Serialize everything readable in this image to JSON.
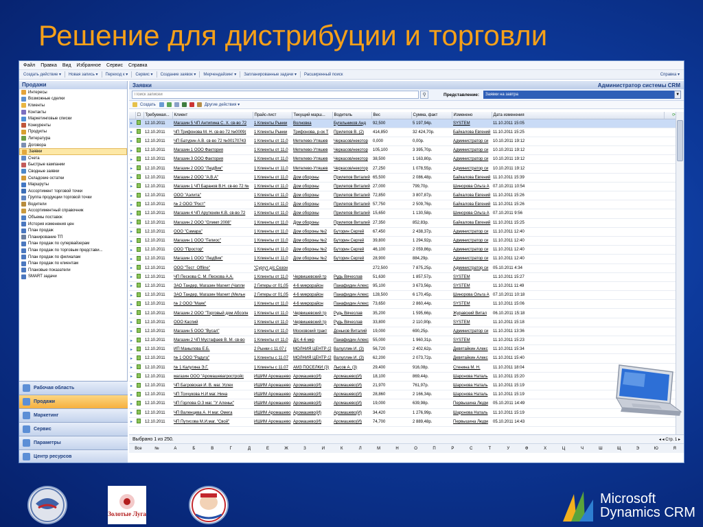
{
  "slide": {
    "title": "Решение для дистрибуции и торговли"
  },
  "colors": {
    "title": "#f5a019",
    "background": "#0d3a9c",
    "selected_row": "#c9dbf6",
    "active_nav": "#f6b03f"
  },
  "menu": [
    "Файл",
    "Правка",
    "Вид",
    "Избранное",
    "Сервис",
    "Справка"
  ],
  "toolbar": {
    "items": [
      "Создать действие ▾",
      "Новая запись ▾",
      "Переход к ▾",
      "Сервис ▾",
      "Создание заявок ▾",
      "Мерчендайзинг ▾",
      "Запланированные задачи ▾",
      "Расширенный поиск"
    ],
    "help": "Справка ▾"
  },
  "sidebar": {
    "title": "Продажи",
    "items": [
      {
        "label": "Интересы",
        "icon": "interest-icon"
      },
      {
        "label": "Возможные сделки",
        "icon": "deal-icon"
      },
      {
        "label": "Клиенты",
        "icon": "clients-icon"
      },
      {
        "label": "Контакты",
        "icon": "contacts-icon"
      },
      {
        "label": "Маркетинговые списки",
        "icon": "marketing-list-icon"
      },
      {
        "label": "Конкуренты",
        "icon": "competitors-icon"
      },
      {
        "label": "Продукты",
        "icon": "products-icon"
      },
      {
        "label": "Литература",
        "icon": "literature-icon"
      },
      {
        "label": "Договора",
        "icon": "contracts-icon"
      },
      {
        "label": "Заявки",
        "icon": "orders-icon",
        "active": true
      },
      {
        "label": "Счета",
        "icon": "invoices-icon"
      },
      {
        "label": "Быстрые кампании",
        "icon": "campaign-icon"
      },
      {
        "label": "Сводные заявки",
        "icon": "summary-orders-icon"
      },
      {
        "label": "Складские остатки",
        "icon": "stock-icon"
      },
      {
        "label": "Маршруты",
        "icon": "routes-icon"
      },
      {
        "label": "Ассортимент торговой точки",
        "icon": "assortment-icon"
      },
      {
        "label": "Группа продукции торговой точки",
        "icon": "product-group-icon"
      },
      {
        "label": "Водители",
        "icon": "drivers-icon"
      },
      {
        "label": "Ассортиментный справочник",
        "icon": "catalog-icon"
      },
      {
        "label": "Объемы поставок",
        "icon": "volume-icon"
      },
      {
        "label": "История изменения цен",
        "icon": "price-history-icon"
      },
      {
        "label": "План продаж",
        "icon": "sales-plan-icon"
      },
      {
        "label": "Планирование ТП",
        "icon": "planning-icon"
      },
      {
        "label": "План продаж по супервайзерам",
        "icon": "plan-supervisor-icon"
      },
      {
        "label": "План продаж по торговым представи...",
        "icon": "plan-rep-icon"
      },
      {
        "label": "План продаж по филиалам",
        "icon": "plan-branch-icon"
      },
      {
        "label": "План продаж по клиентам",
        "icon": "plan-client-icon"
      },
      {
        "label": "Плановые показатели",
        "icon": "targets-icon"
      },
      {
        "label": "SMART задачи",
        "icon": "smart-icon"
      }
    ]
  },
  "navbuttons": [
    {
      "label": "Рабочая область",
      "icon": "workplace-icon"
    },
    {
      "label": "Продажи",
      "icon": "sales-icon",
      "active": true
    },
    {
      "label": "Маркетинг",
      "icon": "marketing-icon"
    },
    {
      "label": "Сервис",
      "icon": "service-icon"
    },
    {
      "label": "Параметры",
      "icon": "settings-icon"
    },
    {
      "label": "Центр ресурсов",
      "icon": "resource-center-icon"
    }
  ],
  "main": {
    "title": "Заявки",
    "admin": "Администратор системы CRM",
    "search_placeholder": "Поиск записей",
    "view_label": "Представление:",
    "view_value": "Заявки на завтра",
    "actions": [
      "Создать",
      "Другие действия ▾"
    ]
  },
  "grid": {
    "columns": [
      "Требуемая...",
      "Клиент",
      "Прайс-лист",
      "Текущий марш...",
      "Водитель",
      "Вес",
      "Сумма, факт",
      "Изменено",
      "Дата изменения"
    ],
    "rows": [
      [
        "12.10.2011",
        "Магазин 5 ЧП Антипина С. Х. св-во 72",
        "1 Клиенты Рынки",
        "Волновка",
        "Бугельников Анд",
        "92,500",
        "5 197,94р.",
        "SYSTEM",
        "11.10.2011 15:05"
      ],
      [
        "12.10.2011",
        "ЧП Трифонова М. Н. св-во 72 №0009(",
        "1 Клиенты Рынки",
        "Трифонова, р-ок Т",
        "Прилепов В. (2)",
        "414,850",
        "32 424,70р.",
        "Байкалова Евгений",
        "11.10.2011 15:25"
      ],
      [
        "12.10.2011",
        "ЧП Батурин А.В. св-во 72 №00170743",
        "1 Клиенты от 11,0",
        "Метелево-Утяшев",
        "Черкасов/некотор",
        "0,000",
        "0,00р.",
        "Администратор си",
        "10.10.2011 19:12"
      ],
      [
        "12.10.2011",
        "Магазин 1 ООО Фактория",
        "1 Клиенты от 11,0",
        "Метелево-Утяшев",
        "Черкасов/некотор",
        "105,100",
        "3 395,70р.",
        "Администратор си",
        "10.10.2011 19:12"
      ],
      [
        "12.10.2011",
        "Магазин 3 ООО Фактория",
        "1 Клиенты от 11,0",
        "Метелево-Утяшев",
        "Черкасов/некотор",
        "38,500",
        "1 163,80р.",
        "Администратор си",
        "10.10.2011 19:12"
      ],
      [
        "12.10.2011",
        "Магазин 2 ООО \"ЛюдВик\"",
        "1 Клиенты от 11,0",
        "Метелево-Утяшев",
        "Черкасов/некотор",
        "27,250",
        "1 078,55р.",
        "Администратор си",
        "10.10.2011 19:12"
      ],
      [
        "12.10.2011",
        "Магазин 2 ООО \"А.В.А\"",
        "1 Клиенты от 11,0",
        "Дом обороны",
        "Прилепов Виталий",
        "65,500",
        "2 086,48р.",
        "Байкалова Евгений",
        "11.10.2011 15:39"
      ],
      [
        "12.10.2011",
        "Магазин 1 ЧП Баранов В.Н. св-во 72 №",
        "1 Клиенты от 11,0",
        "Дом обороны",
        "Прилепов Виталий",
        "27,000",
        "799,70р.",
        "Шинорова Ольга А",
        "07.10.2011 10:54"
      ],
      [
        "12.10.2011",
        "ООО \"Аэлита\"",
        "1 Клиенты от 11,0",
        "Дом обороны",
        "Прилепов Виталий",
        "72,850",
        "3 807,87р.",
        "Байкалова Евгений",
        "11.10.2011 15:26"
      ],
      [
        "12.10.2011",
        "№ 2 ООО \"Рост\"",
        "1 Клиенты от 11,0",
        "Дом обороны",
        "Прилепов Виталий",
        "57,750",
        "2 509,76р.",
        "Байкалова Евгений",
        "11.10.2011 15:26"
      ],
      [
        "12.10.2011",
        "Магазин 4 ЧП Арутюнян К.В. св-во 72",
        "1 Клиенты от 11,0",
        "Дом обороны",
        "Прилепов Виталий",
        "15,650",
        "1 130,58р.",
        "Шинорова Ольга А",
        "07.10.2011 9:56"
      ],
      [
        "12.10.2011",
        "Магазин 2 ООО \"Олимп 2008\"",
        "1 Клиенты от 11,0",
        "Дом обороны",
        "Прилепов Виталий",
        "27,350",
        "852,83р.",
        "Байкалова Евгений",
        "11.10.2011 15:25"
      ],
      [
        "12.10.2011",
        "ООО \"Самара\"",
        "1 Клиенты от 11,0",
        "Дом обороны №2",
        "Буторин Сергей",
        "67,450",
        "2 438,37р.",
        "Администратор си",
        "11.10.2011 12:40"
      ],
      [
        "12.10.2011",
        "Магазин 1 ООО \"Гелиос\"",
        "1 Клиенты от 11,0",
        "Дом обороны №2",
        "Буторин Сергей",
        "39,800",
        "1 294,92р.",
        "Администратор си",
        "11.10.2011 12:40"
      ],
      [
        "12.10.2011",
        "ООО \"Простор\"",
        "1 Клиенты от 11,0",
        "Дом обороны №2",
        "Буторин Сергей",
        "46,100",
        "2 059,86р.",
        "Администратор си",
        "11.10.2011 12:40"
      ],
      [
        "12.10.2011",
        "Магазин 1 ООО \"ЛюдВик\"",
        "1 Клиенты от 11,0",
        "Дом обороны №2",
        "Буторин Сергей",
        "28,900",
        "884,29р.",
        "Администратор си",
        "11.10.2011 12:40"
      ],
      [
        "12.10.2011",
        "ООО \"Тест_Offline\"",
        "\"Сургут д/с Сезон",
        "",
        "",
        "272,500",
        "7 875,25р.",
        "Администратор си",
        "05.10.2011 4:34"
      ],
      [
        "12.10.2011",
        "ЧП Пескова С. М. Пескова А.А.",
        "1 Клиенты от 11,0",
        "Червишевский тр",
        "Рудь Вячеслав",
        "51,630",
        "1 857,57р.",
        "SYSTEM",
        "11.10.2011 15:27"
      ],
      [
        "12.10.2011",
        "ЗАО Тандер, Магазин Магнит (Чапли",
        "2 Гиперы от 01,05",
        "4-6 микрорайон",
        "Панафидин Алекс",
        "95,100",
        "3 673,56р.",
        "SYSTEM",
        "11.10.2011 11:49"
      ],
      [
        "12.10.2011",
        "ЗАО Тандер, Магазин Магнит (Мельн",
        "2 Гиперы от 01,05",
        "4-6 микрорайон",
        "Панафидин Алекс",
        "128,500",
        "6 170,45р.",
        "Шинорова Ольга А",
        "07.10.2011 10:18"
      ],
      [
        "12.10.2011",
        "№ 2 ООО \"Маяк\"",
        "1 Клиенты от 11,0",
        "4-6 микрорайон",
        "Панафидин Алекс",
        "73,650",
        "2 860,44р.",
        "SYSTEM",
        "11.10.2011 15:06"
      ],
      [
        "12.10.2011",
        "Магазин 2 ООО \"Торговый дом Абсолн",
        "1 Клиенты от 11,0",
        "Червишевский тр",
        "Рудь Вячеслав",
        "35,200",
        "1 595,66р.",
        "Журавский Витал",
        "06.10.2011 15:18"
      ],
      [
        "12.10.2011",
        "ООО Каспий",
        "1 Клиенты от 11,0",
        "Червишевский тр",
        "Рудь Вячеслав",
        "33,800",
        "2 110,90р.",
        "SYSTEM",
        "11.10.2011 15:18"
      ],
      [
        "12.10.2011",
        "Магазин 5 ООО \"Вусал\"",
        "1 Клиенты от 11,0",
        "Московский тракт",
        "Доньков Виталий",
        "19,000",
        "690,25р.",
        "Администратор си",
        "11.10.2011 13:36"
      ],
      [
        "12.10.2011",
        "Магазин 2 ЧП Мустафаев В. М. св-во",
        "1 Клиенты от 11,0",
        "Д/с 4-6 мкр",
        "Панафидин Алекс",
        "55,000",
        "1 960,31р.",
        "SYSTEM",
        "11.10.2011 15:23"
      ],
      [
        "12.10.2011",
        "ИП Манылова Е.Б.",
        "2 Рынки с 11.07 (",
        "МОЛНИЯ ЦЕНТР (2",
        "Валуллин И. (3)",
        "56,720",
        "2 402,62р.",
        "Девятайкин Алекс",
        "11.10.2011 15:34"
      ],
      [
        "12.10.2011",
        "№ 1 ООО \"Радуга\"",
        "1 Клиенты с 11.07",
        "МОЛНИЯ ЦЕНТР (2",
        "Валуллин И. (3)",
        "62,200",
        "2 073,72р.",
        "Девятайкин Алекс",
        "11.10.2011 15:40"
      ],
      [
        "12.10.2011",
        "№ 1 Калугина Э.Г.",
        "1 Клиенты с 11.07",
        "АМЗ ПОСЕЛКИ (3)",
        "Лысов А. (3)",
        "29,400",
        "916,08р.",
        "Стенина М. Н.",
        "11.10.2011 18:04"
      ],
      [
        "12.10.2011",
        "магазин ООО \"Аромашевагростройс",
        "ИШИМ Аромашево",
        "Аромашево(И)",
        "Аромашево(И)",
        "18,100",
        "869,44р.",
        "Шаронова Наталь",
        "11.10.2011 15:20"
      ],
      [
        "12.10.2011",
        "ЧП Багровская И. В. маг. Успех",
        "ИШИМ Аромашево",
        "Аромашево(И)",
        "Аромашево(И)",
        "21,970",
        "761,97р.",
        "Шаронова Наталь",
        "11.10.2011 15:19"
      ],
      [
        "12.10.2011",
        "ЧП Тохчукова Н.И маг. Нина",
        "ИШИМ Аромашево",
        "Аромашево(И)",
        "Аромашево(И)",
        "28,860",
        "2 166,34р.",
        "Шаронова Наталь",
        "11.10.2011 15:19"
      ],
      [
        "12.10.2011",
        "ЧП Горлова О.З маг. \"У Аленьк\"",
        "ИШИМ Аромашево",
        "Аромашево(И)",
        "Аромашево(И)",
        "19,000",
        "639,98р.",
        "Первышина Людм",
        "05.10.2011 14:49"
      ],
      [
        "12.10.2011",
        "ЧП Валенцева А. Н маг. Омега",
        "ИШИМ Аромашево",
        "Аромашево(И)",
        "Аромашево(И)",
        "34,420",
        "1 276,99р.",
        "Шаронова Наталь",
        "11.10.2011 15:19"
      ],
      [
        "12.10.2011",
        "ЧП Путисова М.И.маг. \"Свой\"",
        "ИШИМ Аромашево",
        "Аромашево(И)",
        "Аромашево(И)",
        "74,700",
        "2 889,48р.",
        "Первышина Людм",
        "05.10.2011 14:43"
      ]
    ]
  },
  "status": {
    "selected": "Выбрано 1 из 250.",
    "page": "◂ ◂ Стр. 1 ▸"
  },
  "alphabet": [
    "Все",
    "№",
    "А",
    "Б",
    "В",
    "Г",
    "Д",
    "Е",
    "Ж",
    "З",
    "И",
    "К",
    "Л",
    "М",
    "Н",
    "О",
    "П",
    "Р",
    "С",
    "Т",
    "У",
    "Ф",
    "Х",
    "Ц",
    "Ч",
    "Ш",
    "Щ",
    "Э",
    "Ю",
    "Я"
  ],
  "logos": {
    "zolotye_luga": "Золотые Луга",
    "doktor": "Доктор МЭ",
    "ms_line1": "Microsoft",
    "ms_line2": "Dynamics CRM"
  }
}
